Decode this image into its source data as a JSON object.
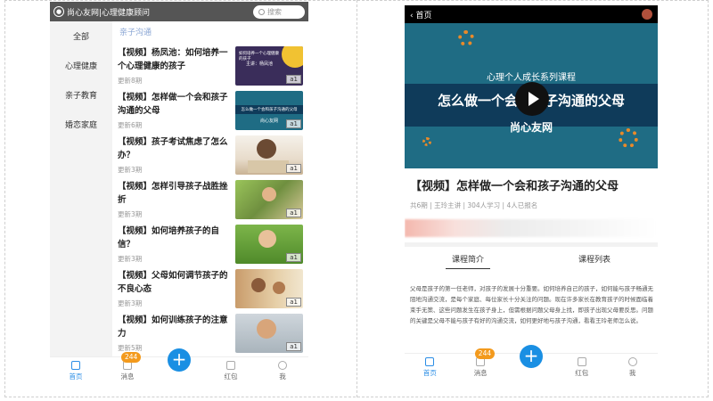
{
  "left": {
    "brand": "尚心友网|心理健康顾问",
    "search_placeholder": "搜索",
    "categories": [
      "全部",
      "心理健康",
      "亲子教育",
      "婚恋家庭"
    ],
    "section_title": "亲子沟通",
    "items": [
      {
        "title": "【视频】杨凤池：如何培养一个心理健康的孩子",
        "update": "更新8期",
        "badge": "a1"
      },
      {
        "title": "【视频】怎样做一个会和孩子沟通的父母",
        "update": "更新6期",
        "badge": "a1"
      },
      {
        "title": "【视频】孩子考试焦虑了怎么办？",
        "update": "更新3期",
        "badge": "a1"
      },
      {
        "title": "【视频】怎样引导孩子战胜挫折",
        "update": "更新3期",
        "badge": "a1"
      },
      {
        "title": "【视频】如何培养孩子的自信？",
        "update": "更新3期",
        "badge": "a1"
      },
      {
        "title": "【视频】父母如何调节孩子的不良心态",
        "update": "更新3期",
        "badge": "a1"
      },
      {
        "title": "【视频】如何训练孩子的注意力",
        "update": "更新5期",
        "badge": "a1"
      }
    ],
    "thumb_texts": [
      "如何培养一个心理健康的孩子",
      "主讲：杨凤池",
      "怎么做一个会和孩子沟通的父母",
      "尚心友网"
    ]
  },
  "tabbar": {
    "home": "首页",
    "messages": "消息",
    "message_count": "244",
    "plus": "+",
    "redpacket": "红包",
    "me": "我"
  },
  "right": {
    "back_label": "首页",
    "video_line1": "心理个人成长系列课程",
    "video_line2": "怎么做一个会和孩子沟通的父母",
    "video_line3": "尚心友网",
    "title": "【视频】怎样做一个会和孩子沟通的父母",
    "meta": "共6期 | 王玲主讲 | 304人学习 | 4人已报名",
    "tabs": [
      "课程简介",
      "课程列表"
    ],
    "description": "父母是孩子的第一任老师，对孩子的发展十分重要。如何培养自己的孩子，如何能与孩子畅通无阻地沟通交流，是每个家庭、每位家长十分关注的问题。现在许多家长在教育孩子的时候面临着束手无策、这些问题发生在孩子身上，但需根据问题父母身上找，即孩子出现父母要反思。问题的关键是父母不能与孩子有好的沟通交流，如何更好地与孩子沟通，看看王玲老师怎么说。"
  },
  "colors": {
    "accent": "#1a8fe3",
    "badge_orange": "#f39a1d",
    "video_teal": "#1f6c84",
    "section_blue": "#8aa6d4"
  }
}
